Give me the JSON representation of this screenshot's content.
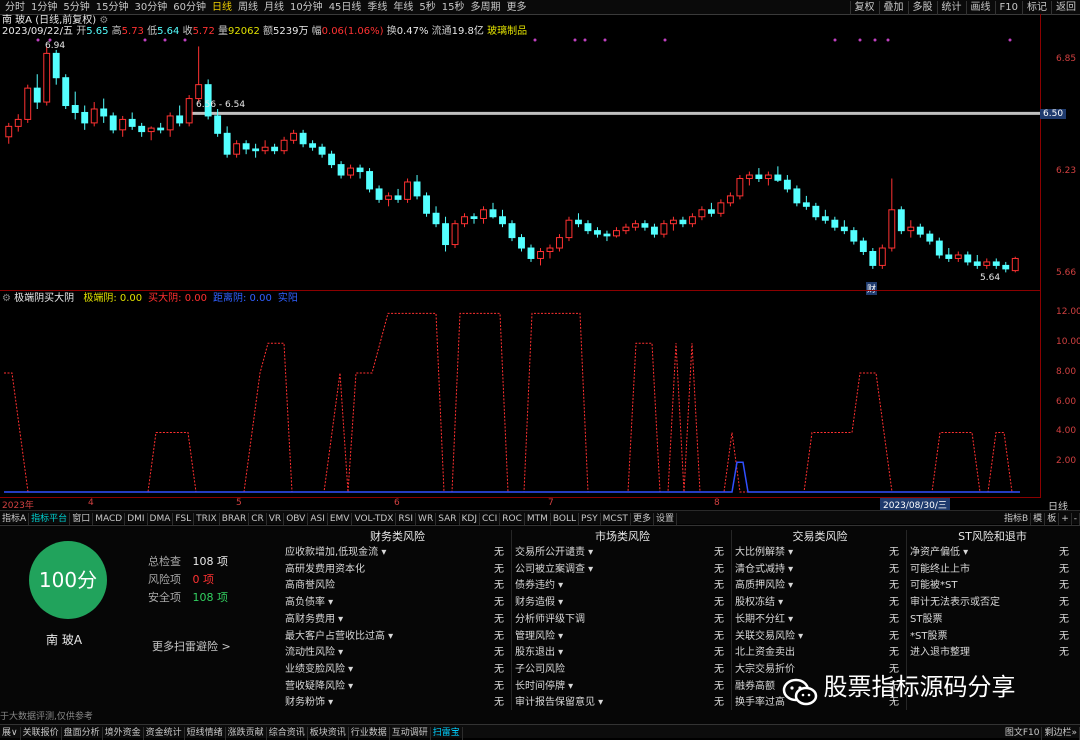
{
  "topbar": {
    "periods": [
      "分时",
      "1分钟",
      "5分钟",
      "15分钟",
      "30分钟",
      "60分钟",
      "日线",
      "周线",
      "月线",
      "10分钟",
      "45日线",
      "季线",
      "年线",
      "5秒",
      "15秒",
      "多周期",
      "更多"
    ],
    "active_period": "日线",
    "right_buttons": [
      "复权",
      "叠加",
      "多股",
      "统计",
      "画线",
      "F10",
      "标记",
      "返回"
    ],
    "nav_arrows": "+①"
  },
  "header": {
    "stock_line": "南 玻A (日线,前复权)",
    "date": "2023/09/22/五",
    "open_label": "开",
    "open": "5.65",
    "high_label": "高",
    "high": "5.73",
    "low_label": "低",
    "low": "5.64",
    "close_label": "收",
    "close": "5.72",
    "volume_label": "量",
    "volume": "92062",
    "amount_label": "额",
    "amount": "5239万",
    "change_label": "幅",
    "change": "0.06(1.06%)",
    "turnover_label": "换",
    "turnover": "0.47%",
    "float_label": "流通",
    "float": "19.8亿",
    "industry": "玻璃制品"
  },
  "price_axis": {
    "labels": [
      "6.85",
      "6.50",
      "6.23",
      "5.66"
    ],
    "current": "6.50"
  },
  "chart_annotations": {
    "high_mark": "6.94",
    "mid_mark": "6.56 - 6.54",
    "low_mark": "5.64",
    "finance_mark": "财"
  },
  "indicator": {
    "name": "极端阴买大阴",
    "legend": [
      {
        "label": "极端阴: 0.00",
        "color": "#e0e000"
      },
      {
        "label": "买大阴: 0.00",
        "color": "#ff3030"
      },
      {
        "label": "距离阴: 0.00",
        "color": "#3060ff"
      },
      {
        "label": "实阳",
        "color": "#3060ff"
      }
    ],
    "axis_labels": [
      "12.00",
      "10.00",
      "8.00",
      "6.00",
      "4.00",
      "2.00"
    ]
  },
  "date_axis": {
    "labels": [
      "2023年",
      "4",
      "5",
      "6",
      "7",
      "8"
    ],
    "selected": "2023/08/30/三",
    "period_btn": "日线"
  },
  "tabs": {
    "items": [
      "指标A",
      "指标平台",
      "窗口",
      "MACD",
      "DMI",
      "DMA",
      "FSL",
      "TRIX",
      "BRAR",
      "CR",
      "VR",
      "OBV",
      "ASI",
      "EMV",
      "VOL-TDX",
      "RSI",
      "WR",
      "SAR",
      "KDJ",
      "CCI",
      "ROC",
      "MTM",
      "BOLL",
      "PSY",
      "MCST",
      "更多",
      "设置"
    ],
    "active": "指标平台",
    "right": [
      "指标B",
      "模",
      "板",
      "+",
      "-"
    ]
  },
  "scan": {
    "score": "100分",
    "stock_name": "南 玻A",
    "total_label": "总检查",
    "total": "108 项",
    "risk_label": "风险项",
    "risk": "0 项",
    "safe_label": "安全项",
    "safe": "108 项",
    "more": "更多扫雷避险 >",
    "footnote": "于大数据评测,仅供参考",
    "columns": [
      {
        "title": "财务类风险",
        "items": [
          {
            "label": "应收款增加,低现金流 ▾",
            "value": "无"
          },
          {
            "label": "高研发费用资本化",
            "value": "无"
          },
          {
            "label": "高商誉风险",
            "value": "无"
          },
          {
            "label": "高负债率 ▾",
            "value": "无"
          },
          {
            "label": "高财务费用 ▾",
            "value": "无"
          },
          {
            "label": "最大客户占营收比过高 ▾",
            "value": "无"
          },
          {
            "label": "流动性风险 ▾",
            "value": "无"
          },
          {
            "label": "业绩变脸风险 ▾",
            "value": "无"
          },
          {
            "label": "营收疑降风险 ▾",
            "value": "无"
          },
          {
            "label": "财务粉饰 ▾",
            "value": "无"
          }
        ]
      },
      {
        "title": "市场类风险",
        "items": [
          {
            "label": "交易所公开谴责 ▾",
            "value": "无"
          },
          {
            "label": "公司被立案调查 ▾",
            "value": "无"
          },
          {
            "label": "债券违约 ▾",
            "value": "无"
          },
          {
            "label": "财务造假 ▾",
            "value": "无"
          },
          {
            "label": "分析师评级下调",
            "value": "无"
          },
          {
            "label": "管理风险 ▾",
            "value": "无"
          },
          {
            "label": "股东退出 ▾",
            "value": "无"
          },
          {
            "label": "子公司风险",
            "value": "无"
          },
          {
            "label": "长时间停牌 ▾",
            "value": "无"
          },
          {
            "label": "审计报告保留意见 ▾",
            "value": "无"
          }
        ]
      },
      {
        "title": "交易类风险",
        "items": [
          {
            "label": "大比例解禁 ▾",
            "value": "无"
          },
          {
            "label": "清仓式减持 ▾",
            "value": "无"
          },
          {
            "label": "高质押风险 ▾",
            "value": "无"
          },
          {
            "label": "股权冻结 ▾",
            "value": "无"
          },
          {
            "label": "长期不分红 ▾",
            "value": "无"
          },
          {
            "label": "关联交易风险 ▾",
            "value": "无"
          },
          {
            "label": "北上资金卖出",
            "value": "无"
          },
          {
            "label": "大宗交易折价",
            "value": "无"
          },
          {
            "label": "融券高额",
            "value": "无"
          },
          {
            "label": "换手率过高",
            "value": "无"
          }
        ]
      },
      {
        "title": "ST风险和退市",
        "items": [
          {
            "label": "净资产偏低 ▾",
            "value": "无"
          },
          {
            "label": "可能终止上市",
            "value": "无"
          },
          {
            "label": "可能被*ST",
            "value": "无"
          },
          {
            "label": "审计无法表示或否定",
            "value": "无"
          },
          {
            "label": "ST股票",
            "value": "无"
          },
          {
            "label": "*ST股票",
            "value": "无"
          },
          {
            "label": "进入退市整理",
            "value": "无"
          }
        ]
      }
    ]
  },
  "bottombar": {
    "items": [
      "展∨",
      "关联报价",
      "盘面分析",
      "境外资金",
      "资金统计",
      "短线情绪",
      "涨跌贡献",
      "综合资讯",
      "板块资讯",
      "行业数据",
      "互动调研",
      "扫雷宝"
    ],
    "active": "扫雷宝",
    "right": [
      "图文F10",
      "剩边栏»"
    ]
  },
  "watermark": {
    "text": "股票指标源码分享"
  },
  "colors": {
    "up": "#ff3232",
    "down": "#54ffff",
    "ind_line": "#ff3030",
    "ind_blue": "#3050ff",
    "cur_line": "#c0c0c0",
    "axis": "#8b0000",
    "score_bg": "#21a35c"
  },
  "chart_data": {
    "type": "candlestick",
    "y_range": [
      5.55,
      7.0
    ],
    "candles": [
      [
        6.42,
        6.5,
        6.38,
        6.48
      ],
      [
        6.48,
        6.55,
        6.45,
        6.52
      ],
      [
        6.52,
        6.72,
        6.5,
        6.7
      ],
      [
        6.7,
        6.78,
        6.58,
        6.62
      ],
      [
        6.62,
        6.94,
        6.6,
        6.9
      ],
      [
        6.9,
        6.92,
        6.72,
        6.76
      ],
      [
        6.76,
        6.78,
        6.58,
        6.6
      ],
      [
        6.6,
        6.68,
        6.52,
        6.56
      ],
      [
        6.56,
        6.6,
        6.46,
        6.5
      ],
      [
        6.5,
        6.62,
        6.48,
        6.58
      ],
      [
        6.58,
        6.64,
        6.5,
        6.54
      ],
      [
        6.54,
        6.56,
        6.44,
        6.46
      ],
      [
        6.46,
        6.54,
        6.42,
        6.52
      ],
      [
        6.52,
        6.56,
        6.46,
        6.48
      ],
      [
        6.48,
        6.5,
        6.42,
        6.45
      ],
      [
        6.45,
        6.48,
        6.4,
        6.47
      ],
      [
        6.47,
        6.5,
        6.44,
        6.46
      ],
      [
        6.46,
        6.56,
        6.42,
        6.54
      ],
      [
        6.54,
        6.6,
        6.48,
        6.5
      ],
      [
        6.5,
        6.66,
        6.48,
        6.64
      ],
      [
        6.64,
        6.94,
        6.62,
        6.72
      ],
      [
        6.72,
        6.75,
        6.52,
        6.54
      ],
      [
        6.54,
        6.58,
        6.42,
        6.44
      ],
      [
        6.44,
        6.48,
        6.3,
        6.32
      ],
      [
        6.32,
        6.4,
        6.3,
        6.38
      ],
      [
        6.38,
        6.4,
        6.32,
        6.35
      ],
      [
        6.35,
        6.38,
        6.3,
        6.34
      ],
      [
        6.34,
        6.4,
        6.32,
        6.36
      ],
      [
        6.36,
        6.38,
        6.32,
        6.34
      ],
      [
        6.34,
        6.42,
        6.32,
        6.4
      ],
      [
        6.4,
        6.46,
        6.38,
        6.44
      ],
      [
        6.44,
        6.46,
        6.36,
        6.38
      ],
      [
        6.38,
        6.4,
        6.34,
        6.36
      ],
      [
        6.36,
        6.38,
        6.3,
        6.32
      ],
      [
        6.32,
        6.34,
        6.24,
        6.26
      ],
      [
        6.26,
        6.28,
        6.18,
        6.2
      ],
      [
        6.2,
        6.26,
        6.18,
        6.24
      ],
      [
        6.24,
        6.26,
        6.18,
        6.22
      ],
      [
        6.22,
        6.24,
        6.1,
        6.12
      ],
      [
        6.12,
        6.14,
        6.04,
        6.06
      ],
      [
        6.06,
        6.1,
        6.02,
        6.08
      ],
      [
        6.08,
        6.12,
        6.04,
        6.06
      ],
      [
        6.06,
        6.18,
        6.04,
        6.16
      ],
      [
        6.16,
        6.2,
        6.06,
        6.08
      ],
      [
        6.08,
        6.1,
        5.96,
        5.98
      ],
      [
        5.98,
        6.02,
        5.9,
        5.92
      ],
      [
        5.92,
        5.96,
        5.76,
        5.8
      ],
      [
        5.8,
        5.94,
        5.78,
        5.92
      ],
      [
        5.92,
        5.98,
        5.9,
        5.96
      ],
      [
        5.96,
        5.98,
        5.92,
        5.95
      ],
      [
        5.95,
        6.02,
        5.92,
        6.0
      ],
      [
        6.0,
        6.04,
        5.95,
        5.96
      ],
      [
        5.96,
        6.0,
        5.9,
        5.92
      ],
      [
        5.92,
        5.94,
        5.82,
        5.84
      ],
      [
        5.84,
        5.86,
        5.76,
        5.78
      ],
      [
        5.78,
        5.8,
        5.7,
        5.72
      ],
      [
        5.72,
        5.78,
        5.68,
        5.76
      ],
      [
        5.76,
        5.8,
        5.72,
        5.78
      ],
      [
        5.78,
        5.86,
        5.76,
        5.84
      ],
      [
        5.84,
        5.96,
        5.82,
        5.94
      ],
      [
        5.94,
        5.98,
        5.9,
        5.92
      ],
      [
        5.92,
        5.94,
        5.86,
        5.88
      ],
      [
        5.88,
        5.9,
        5.84,
        5.86
      ],
      [
        5.86,
        5.88,
        5.82,
        5.85
      ],
      [
        5.85,
        5.9,
        5.84,
        5.88
      ],
      [
        5.88,
        5.92,
        5.86,
        5.9
      ],
      [
        5.9,
        5.94,
        5.88,
        5.92
      ],
      [
        5.92,
        5.94,
        5.88,
        5.9
      ],
      [
        5.9,
        5.92,
        5.84,
        5.86
      ],
      [
        5.86,
        5.94,
        5.84,
        5.92
      ],
      [
        5.92,
        5.96,
        5.88,
        5.94
      ],
      [
        5.94,
        5.96,
        5.9,
        5.92
      ],
      [
        5.92,
        5.98,
        5.9,
        5.96
      ],
      [
        5.96,
        6.02,
        5.94,
        6.0
      ],
      [
        6.0,
        6.04,
        5.96,
        5.98
      ],
      [
        5.98,
        6.06,
        5.96,
        6.04
      ],
      [
        6.04,
        6.1,
        6.02,
        6.08
      ],
      [
        6.08,
        6.2,
        6.06,
        6.18
      ],
      [
        6.18,
        6.22,
        6.14,
        6.2
      ],
      [
        6.2,
        6.24,
        6.16,
        6.18
      ],
      [
        6.18,
        6.22,
        6.14,
        6.2
      ],
      [
        6.2,
        6.25,
        6.16,
        6.17
      ],
      [
        6.17,
        6.2,
        6.1,
        6.12
      ],
      [
        6.12,
        6.14,
        6.02,
        6.04
      ],
      [
        6.04,
        6.08,
        6.0,
        6.02
      ],
      [
        6.02,
        6.04,
        5.94,
        5.96
      ],
      [
        5.96,
        6.0,
        5.92,
        5.94
      ],
      [
        5.94,
        5.96,
        5.88,
        5.9
      ],
      [
        5.9,
        5.94,
        5.86,
        5.88
      ],
      [
        5.88,
        5.9,
        5.8,
        5.82
      ],
      [
        5.82,
        5.84,
        5.74,
        5.76
      ],
      [
        5.76,
        5.78,
        5.66,
        5.68
      ],
      [
        5.68,
        5.8,
        5.66,
        5.78
      ],
      [
        5.78,
        6.18,
        5.76,
        6.0
      ],
      [
        6.0,
        6.02,
        5.86,
        5.88
      ],
      [
        5.88,
        5.94,
        5.84,
        5.9
      ],
      [
        5.9,
        5.92,
        5.84,
        5.86
      ],
      [
        5.86,
        5.88,
        5.8,
        5.82
      ],
      [
        5.82,
        5.84,
        5.72,
        5.74
      ],
      [
        5.74,
        5.78,
        5.7,
        5.72
      ],
      [
        5.72,
        5.76,
        5.7,
        5.74
      ],
      [
        5.74,
        5.76,
        5.68,
        5.7
      ],
      [
        5.7,
        5.74,
        5.66,
        5.68
      ],
      [
        5.68,
        5.72,
        5.66,
        5.7
      ],
      [
        5.7,
        5.72,
        5.66,
        5.68
      ],
      [
        5.68,
        5.7,
        5.64,
        5.66
      ],
      [
        5.65,
        5.73,
        5.64,
        5.72
      ]
    ],
    "indicator_range": [
      0,
      12.5
    ],
    "indicator_red": [
      8,
      8,
      4,
      0,
      0,
      0,
      0,
      0,
      0,
      0,
      0,
      0,
      0,
      0,
      0,
      0,
      0,
      0,
      0,
      4,
      4,
      4,
      4,
      4,
      0,
      0,
      0,
      0,
      0,
      0,
      0,
      4,
      8,
      10,
      10,
      10,
      0,
      0,
      0,
      0,
      0,
      4,
      8,
      0,
      8,
      8,
      8,
      10,
      12,
      12,
      12,
      12,
      12,
      12,
      12,
      0,
      0,
      12,
      12,
      12,
      12,
      12,
      12,
      0,
      0,
      0,
      12,
      12,
      12,
      12,
      12,
      12,
      12,
      0,
      0,
      0,
      0,
      0,
      0,
      10,
      10,
      10,
      0,
      0,
      10,
      0,
      10,
      0,
      0,
      0,
      0,
      4,
      0,
      0,
      0,
      0,
      0,
      0,
      0,
      0,
      0,
      4,
      4,
      4,
      4,
      4,
      4,
      8,
      8,
      8,
      4,
      0,
      0,
      0,
      0,
      0,
      0,
      4,
      4,
      4,
      4,
      4,
      0,
      0,
      4,
      4,
      0
    ],
    "indicator_blue_peak_index": 92
  }
}
